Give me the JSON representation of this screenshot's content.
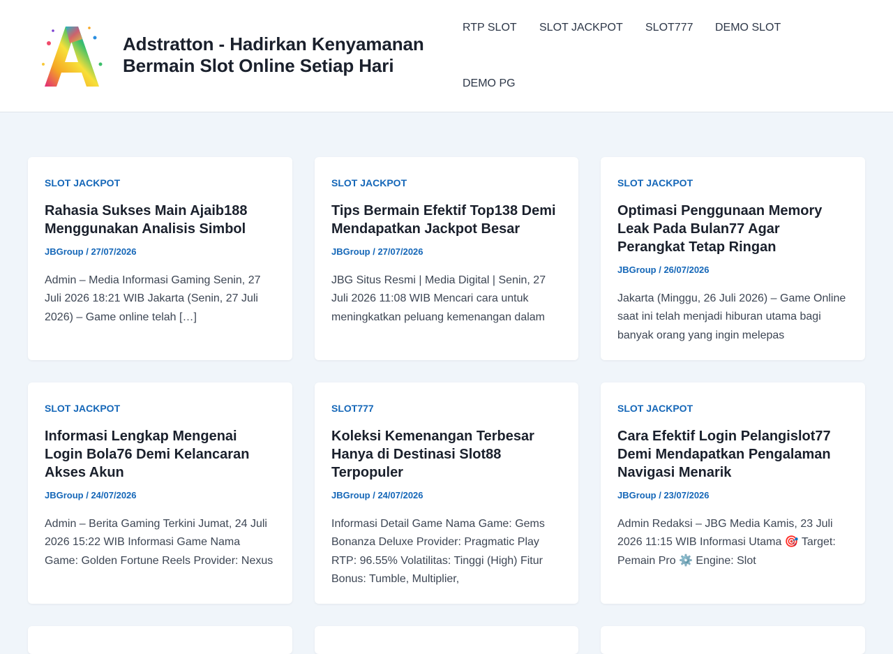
{
  "header": {
    "site_title": "Adstratton - Hadirkan Kenyamanan Bermain Slot Online Setiap Hari",
    "logo_icon": "rainbow-letter-a-logo-icon",
    "nav": [
      {
        "label": "RTP SLOT"
      },
      {
        "label": "SLOT JACKPOT"
      },
      {
        "label": "SLOT777"
      },
      {
        "label": "DEMO SLOT"
      },
      {
        "label": "DEMO PG"
      }
    ]
  },
  "posts": [
    {
      "category": "SLOT JACKPOT",
      "title": "Rahasia Sukses Main Ajaib188 Menggunakan Analisis Simbol",
      "meta": "JBGroup / 27/07/2026",
      "excerpt": "Admin – Media Informasi Gaming Senin, 27 Juli 2026 18:21 WIB Jakarta (Senin, 27 Juli 2026) – Game online telah […]"
    },
    {
      "category": "SLOT JACKPOT",
      "title": "Tips Bermain Efektif Top138 Demi Mendapatkan Jackpot Besar",
      "meta": "JBGroup / 27/07/2026",
      "excerpt": "JBG Situs Resmi | Media Digital | Senin, 27 Juli 2026 11:08 WIB Mencari cara untuk meningkatkan peluang kemenangan dalam"
    },
    {
      "category": "SLOT JACKPOT",
      "title": "Optimasi Penggunaan Memory Leak Pada Bulan77 Agar Perangkat Tetap Ringan",
      "meta": "JBGroup / 26/07/2026",
      "excerpt": "Jakarta (Minggu, 26 Juli 2026) – Game Online saat ini telah menjadi hiburan utama bagi banyak orang yang ingin melepas"
    },
    {
      "category": "SLOT JACKPOT",
      "title": "Informasi Lengkap Mengenai Login Bola76 Demi Kelancaran Akses Akun",
      "meta": "JBGroup / 24/07/2026",
      "excerpt": "Admin – Berita Gaming Terkini Jumat, 24 Juli 2026 15:22 WIB Informasi Game Nama Game: Golden Fortune Reels Provider: Nexus"
    },
    {
      "category": "SLOT777",
      "title": "Koleksi Kemenangan Terbesar Hanya di Destinasi Slot88 Terpopuler",
      "meta": "JBGroup / 24/07/2026",
      "excerpt": "Informasi Detail Game Nama Game: Gems Bonanza Deluxe Provider: Pragmatic Play RTP: 96.55% Volatilitas: Tinggi (High) Fitur Bonus: Tumble, Multiplier,"
    },
    {
      "category": "SLOT JACKPOT",
      "title": "Cara Efektif Login Pelangislot77 Demi Mendapatkan Pengalaman Navigasi Menarik",
      "meta": "JBGroup / 23/07/2026",
      "excerpt": "Admin Redaksi – JBG Media Kamis, 23 Juli 2026 11:15 WIB Informasi Utama 🎯 Target: Pemain Pro ⚙️ Engine: Slot"
    }
  ]
}
